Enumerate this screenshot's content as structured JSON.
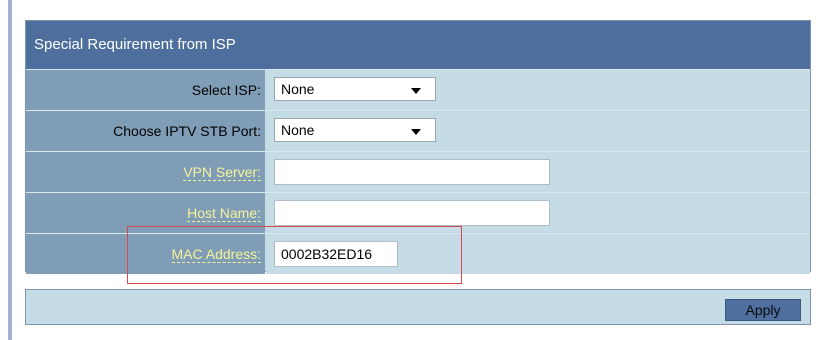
{
  "panel": {
    "title": "Special Requirement from ISP"
  },
  "rows": {
    "isp": {
      "label": "Select ISP:",
      "value": "None"
    },
    "iptv": {
      "label": "Choose IPTV STB Port:",
      "value": "None"
    },
    "vpn": {
      "label": "VPN Server:",
      "value": ""
    },
    "host": {
      "label": "Host Name:",
      "value": ""
    },
    "mac": {
      "label": "MAC Address:",
      "value": "0002B32ED16"
    }
  },
  "footer": {
    "apply_label": "Apply"
  },
  "colors": {
    "header_bg": "#4e6f9d",
    "label_bg": "#7f9db7",
    "value_bg": "#c5dbe6",
    "highlight_label": "#f6f29a",
    "annotation_box": "#d54a4a"
  }
}
